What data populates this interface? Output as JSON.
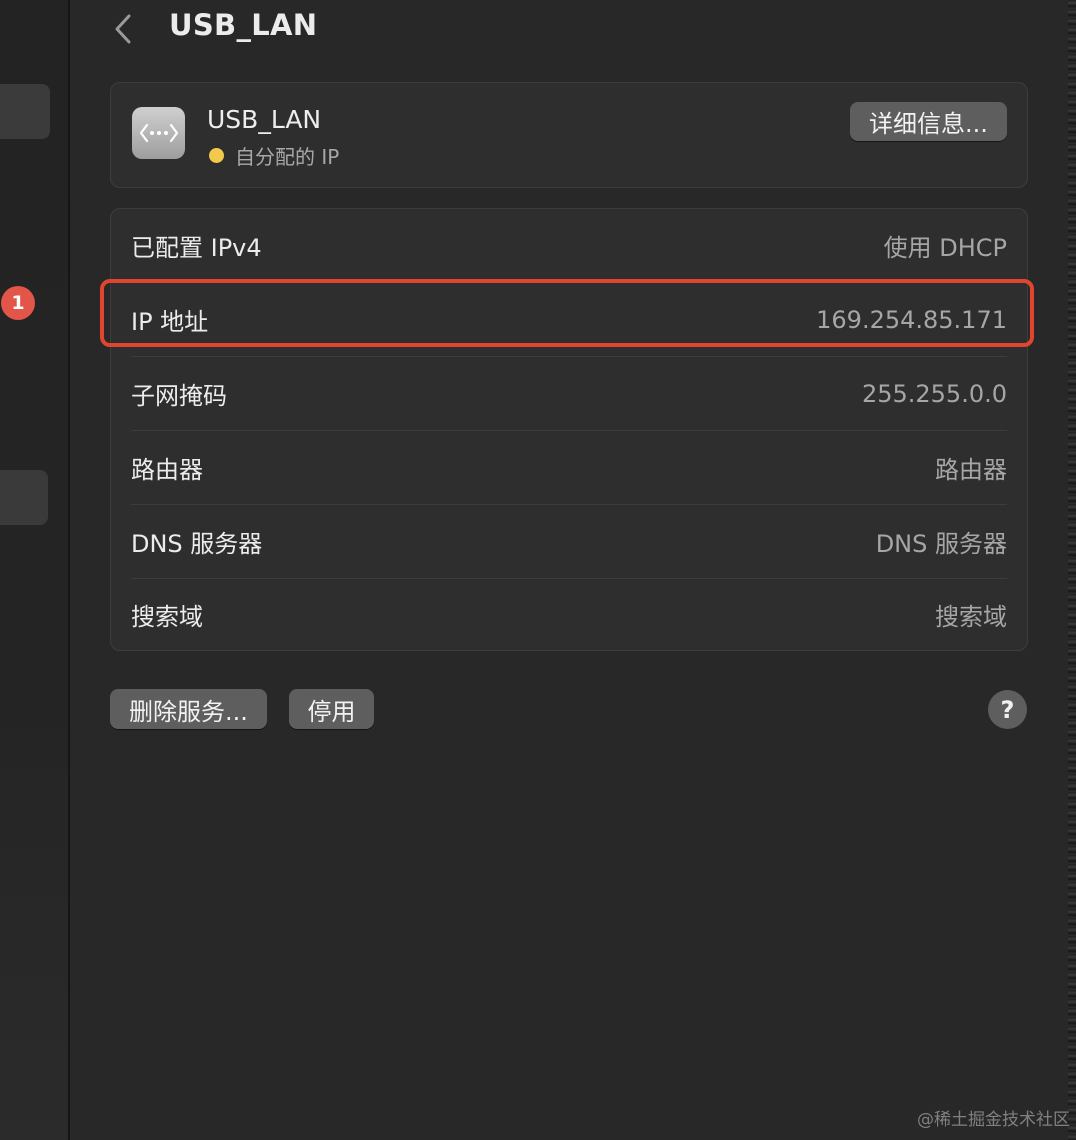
{
  "sidebar": {
    "badge_count": "1"
  },
  "header": {
    "back_icon": "chevron-left-icon",
    "title": "USB_LAN"
  },
  "service": {
    "icon": "network-ellipsis-icon",
    "name": "USB_LAN",
    "status_text": "自分配的 IP",
    "status_color": "#f2c94c",
    "details_button": "详细信息..."
  },
  "details": {
    "rows": [
      {
        "label": "已配置 IPv4",
        "value": "使用 DHCP"
      },
      {
        "label": "IP 地址",
        "value": "169.254.85.171"
      },
      {
        "label": "子网掩码",
        "value": "255.255.0.0"
      },
      {
        "label": "路由器",
        "value": "路由器"
      },
      {
        "label": "DNS 服务器",
        "value": "DNS 服务器"
      },
      {
        "label": "搜索域",
        "value": "搜索域"
      }
    ],
    "highlight_color": "#e0452f"
  },
  "footer": {
    "delete_button": "删除服务...",
    "disable_button": "停用",
    "help_button": "?"
  },
  "watermark": "@稀土掘金技术社区"
}
